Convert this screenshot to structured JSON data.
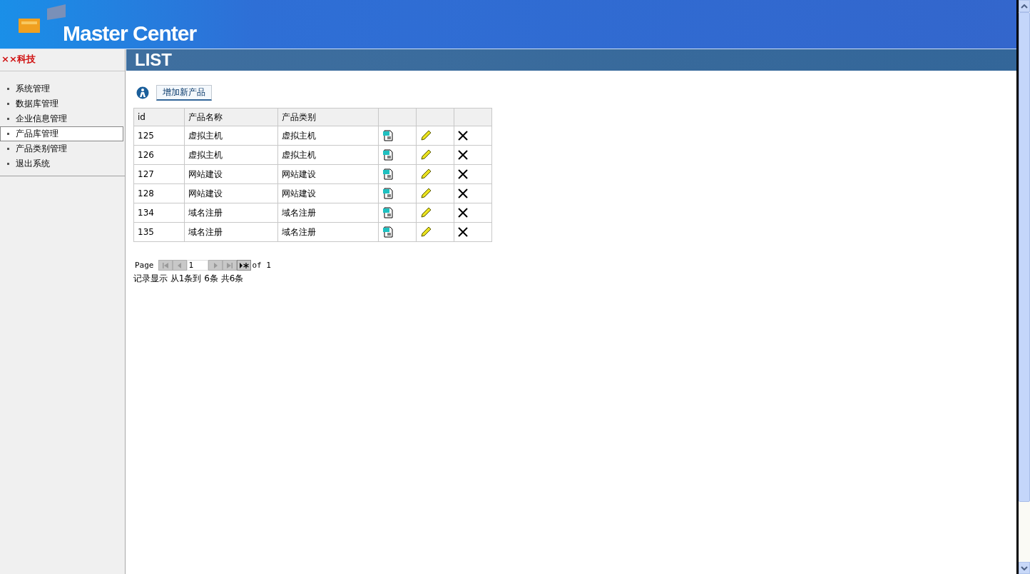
{
  "header": {
    "logo_text": "Master Center"
  },
  "sidebar": {
    "company": "××科技",
    "items": [
      {
        "label": "系统管理",
        "selected": false
      },
      {
        "label": "数据库管理",
        "selected": false
      },
      {
        "label": "企业信息管理",
        "selected": false
      },
      {
        "label": "产品库管理",
        "selected": true
      },
      {
        "label": "产品类别管理",
        "selected": false
      },
      {
        "label": "退出系统",
        "selected": false
      }
    ]
  },
  "banner": {
    "title": "LIST"
  },
  "toolbar": {
    "add_button": "增加新产品"
  },
  "table": {
    "columns": [
      "id",
      "产品名称",
      "产品类别"
    ],
    "rows": [
      {
        "id": "125",
        "name": "虚拟主机",
        "category": "虚拟主机"
      },
      {
        "id": "126",
        "name": "虚拟主机",
        "category": "虚拟主机"
      },
      {
        "id": "127",
        "name": "网站建设",
        "category": "网站建设"
      },
      {
        "id": "128",
        "name": "网站建设",
        "category": "网站建设"
      },
      {
        "id": "134",
        "name": "域名注册",
        "category": "域名注册"
      },
      {
        "id": "135",
        "name": "域名注册",
        "category": "域名注册"
      }
    ]
  },
  "pager": {
    "label": "Page",
    "value": "1",
    "of": "of 1",
    "buttons": [
      {
        "kind": "first",
        "disabled": true
      },
      {
        "kind": "prev",
        "disabled": true
      },
      {
        "kind": "input"
      },
      {
        "kind": "next",
        "disabled": true
      },
      {
        "kind": "last",
        "disabled": true
      },
      {
        "kind": "new",
        "disabled": false
      }
    ],
    "summary": "记录显示 从1条到 6条 共6条"
  }
}
